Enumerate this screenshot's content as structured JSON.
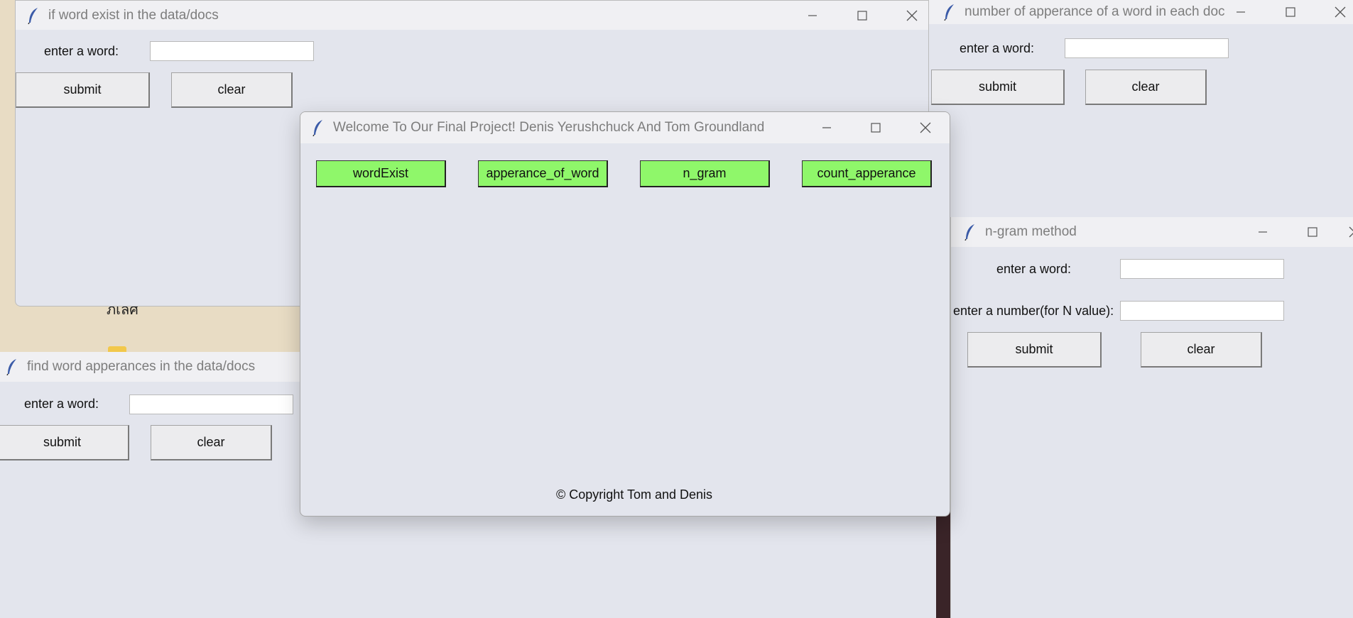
{
  "windows": {
    "word_exist": {
      "title": "if word exist in the data/docs",
      "label": "enter a word:",
      "input_value": "",
      "submit": "submit",
      "clear": "clear"
    },
    "appearance_count": {
      "title": "number of apperance of a word in each doc",
      "label": "enter a word:",
      "input_value": "",
      "submit": "submit",
      "clear": "clear"
    },
    "find_word": {
      "title": "find word apperances in the data/docs",
      "label": "enter a word:",
      "input_value": "",
      "submit": "submit",
      "clear": "clear"
    },
    "ngram": {
      "title": "n-gram method",
      "label_word": "enter a word:",
      "label_number": "enter a number(for N value):",
      "input_word_value": "",
      "input_number_value": "",
      "submit": "submit",
      "clear": "clear"
    },
    "main": {
      "title": "Welcome To Our Final Project! Denis Yerushchuck And Tom Groundland",
      "buttons": [
        "wordExist",
        "apperance_of_word",
        "n_gram",
        "count_apperance"
      ],
      "copyright": "© Copyright Tom and Denis"
    }
  },
  "background_text": "ภิเลิศ",
  "colors": {
    "window_bg": "#e3e5ed",
    "titlebar_bg": "#f0f0f3",
    "main_button": "#8ff76a",
    "desktop": "#e8dcc4"
  },
  "icons": [
    "feather-icon",
    "minimize-icon",
    "maximize-icon",
    "close-icon"
  ]
}
